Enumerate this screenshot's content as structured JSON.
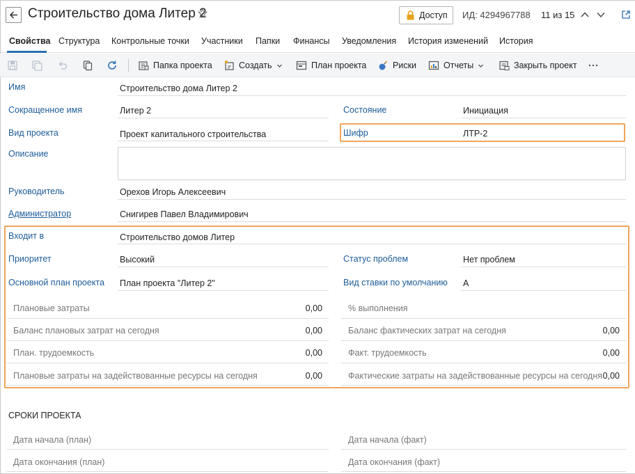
{
  "header": {
    "title": "Строительство дома Литер 2",
    "access_label": "Доступ",
    "record_id": "ИД: 4294967788",
    "counter": "11 из 15"
  },
  "tabs": [
    "Свойства",
    "Структура",
    "Контрольные точки",
    "Участники",
    "Папки",
    "Финансы",
    "Уведомления",
    "История изменений",
    "История"
  ],
  "toolbar": {
    "project_folder": "Папка проекта",
    "create": "Создать",
    "project_plan": "План проекта",
    "risks": "Риски",
    "reports": "Отчеты",
    "close_project": "Закрыть проект"
  },
  "form": {
    "name_label": "Имя",
    "name_value": "Строительство дома Литер 2",
    "short_name_label": "Сокращенное имя",
    "short_name_value": "Литер 2",
    "state_label": "Состояние",
    "state_value": "Инициация",
    "project_type_label": "Вид проекта",
    "project_type_value": "Проект капитального строительства",
    "cipher_label": "Шифр",
    "cipher_value": "ЛТР-2",
    "description_label": "Описание",
    "description_value": "",
    "manager_label": "Руководитель",
    "manager_value": "Орехов Игорь Алексеевич",
    "admin_label": "Администратор",
    "admin_value": "Снигирев Павел Владимирович",
    "parent_label": "Входит в",
    "parent_value": "Строительство домов Литер",
    "priority_label": "Приоритет",
    "priority_value": "Высокий",
    "problem_status_label": "Статус проблем",
    "problem_status_value": "Нет проблем",
    "base_plan_label": "Основной план проекта",
    "base_plan_value": "План проекта \"Литер 2\"",
    "default_rate_label": "Вид ставки по умолчанию",
    "default_rate_value": "А"
  },
  "metrics_left": [
    {
      "label": "Плановые затраты",
      "value": "0,00"
    },
    {
      "label": "Баланс плановых затрат на сегодня",
      "value": "0,00"
    },
    {
      "label": "План. трудоемкость",
      "value": "0,00"
    },
    {
      "label": "Плановые затраты на задействованные ресурсы на сегодня",
      "value": "0,00"
    }
  ],
  "metrics_right": [
    {
      "label": "% выполнения",
      "value": ""
    },
    {
      "label": "Баланс фактических затрат на сегодня",
      "value": "0,00"
    },
    {
      "label": "Факт. трудоемкость",
      "value": "0,00"
    },
    {
      "label": "Фактические затраты на задействованные ресурсы на сегодня",
      "value": "0,00"
    }
  ],
  "timeline": {
    "title": "СРОКИ ПРОЕКТА",
    "start_plan": "Дата начала (план)",
    "start_fact": "Дата начала (факт)",
    "end_plan": "Дата окончания (план)",
    "end_fact": "Дата окончания (факт)"
  },
  "colors": {
    "accent": "#2a6fb0",
    "label": "#1d5c99",
    "highlight": "#f0a55a"
  }
}
